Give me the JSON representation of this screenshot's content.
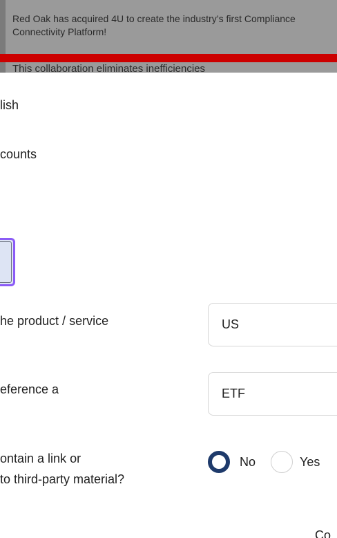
{
  "banner": {
    "headline": "Red Oak has acquired 4U to create the industry’s first Compliance Connectivity Platform!",
    "body": "This collaboration eliminates inefficiencies"
  },
  "form": {
    "language_label": "lish",
    "accounts_label": "counts",
    "product_question": "he product / service",
    "product_value": "US",
    "reference_question": "eference a",
    "reference_value": "ETF",
    "link_question_line1": "ontain a link or",
    "link_question_line2": " to third-party material?",
    "link_options": {
      "no": "No",
      "yes": "Yes"
    },
    "link_selected": "No"
  },
  "footer": {
    "cut_text": "Co"
  },
  "colors": {
    "focus_outline": "#8b5cf6",
    "radio_selected": "#1e3a6b",
    "banner_accent": "#cc0000"
  }
}
